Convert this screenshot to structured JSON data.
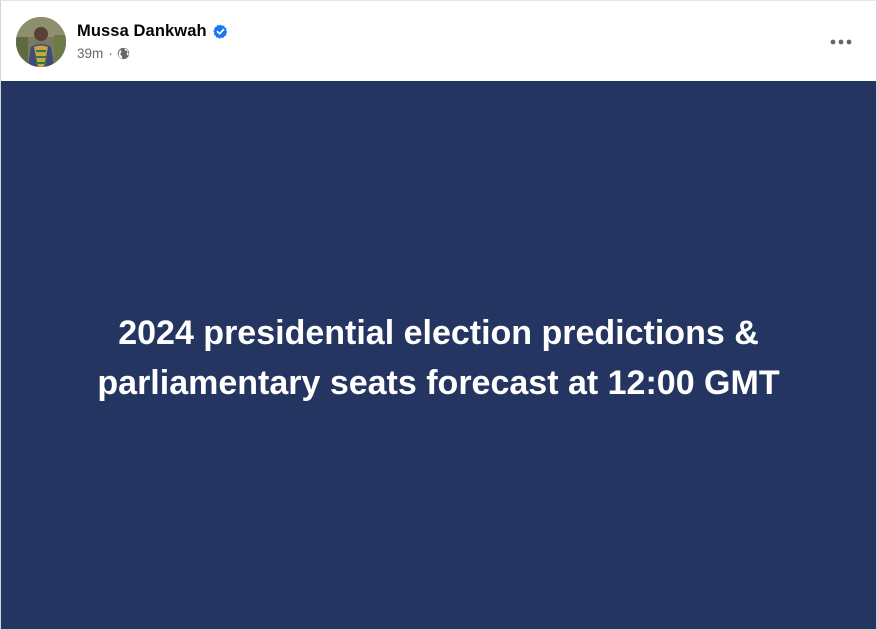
{
  "post": {
    "author_name": "Mussa Dankwah",
    "verified_icon": "verified-badge-icon",
    "timestamp": "39m",
    "separator": "·",
    "audience_icon": "globe-icon",
    "more_icon": "more-options-icon",
    "body_text": "2024 presidential election predictions & parliamentary seats forecast at 12:00 GMT",
    "body_background": "#253561",
    "verified_color": "#1877f2"
  }
}
